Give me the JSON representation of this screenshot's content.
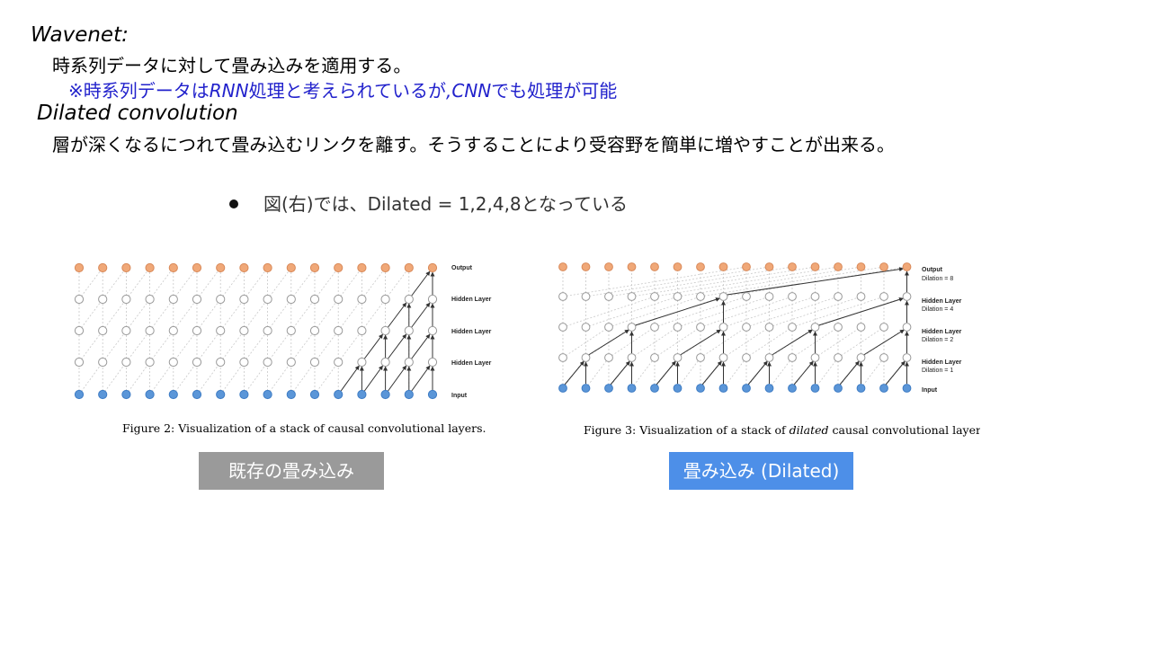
{
  "text": {
    "wavenet_heading": "Wavenet:",
    "wavenet_desc": "時系列データに対して畳み込みを適用する。",
    "note_a": "※時系列データは",
    "note_rnn": "RNN",
    "note_b": "処理と考えられているが",
    "note_cnn": ",CNN",
    "note_c": "でも処理が可能",
    "dilated_heading": "Dilated convolution",
    "dilated_desc": "層が深くなるにつれて畳み込むリンクを離す。そうすることにより受容野を簡単に増やすことが出来る。",
    "bullet": "図(右)では、Dilated = 1,2,4,8となっている"
  },
  "figure2": {
    "layer_labels": [
      "Output",
      "Hidden Layer",
      "Hidden Layer",
      "Hidden Layer",
      "Input"
    ],
    "caption": "Figure 2: Visualization of a stack of causal convolutional layers."
  },
  "figure3": {
    "layer_labels": [
      "Output",
      "Hidden Layer",
      "Hidden Layer",
      "Hidden Layer",
      "Input"
    ],
    "dilation_labels": [
      "Dilation = 8",
      "Dilation = 4",
      "Dilation = 2",
      "Dilation = 1"
    ],
    "caption_pre": "Figure 3: Visualization of a stack of ",
    "caption_em": "dilated",
    "caption_post": " causal convolutional layers."
  },
  "buttons": {
    "left": "既存の畳み込み",
    "right": "畳み込み (Dilated)"
  },
  "colors": {
    "output_node": "#f0a878",
    "input_node": "#5b96d8",
    "note_text": "#2222cc",
    "button_gray": "#9a9a9a",
    "button_blue": "#4d8fe8"
  }
}
